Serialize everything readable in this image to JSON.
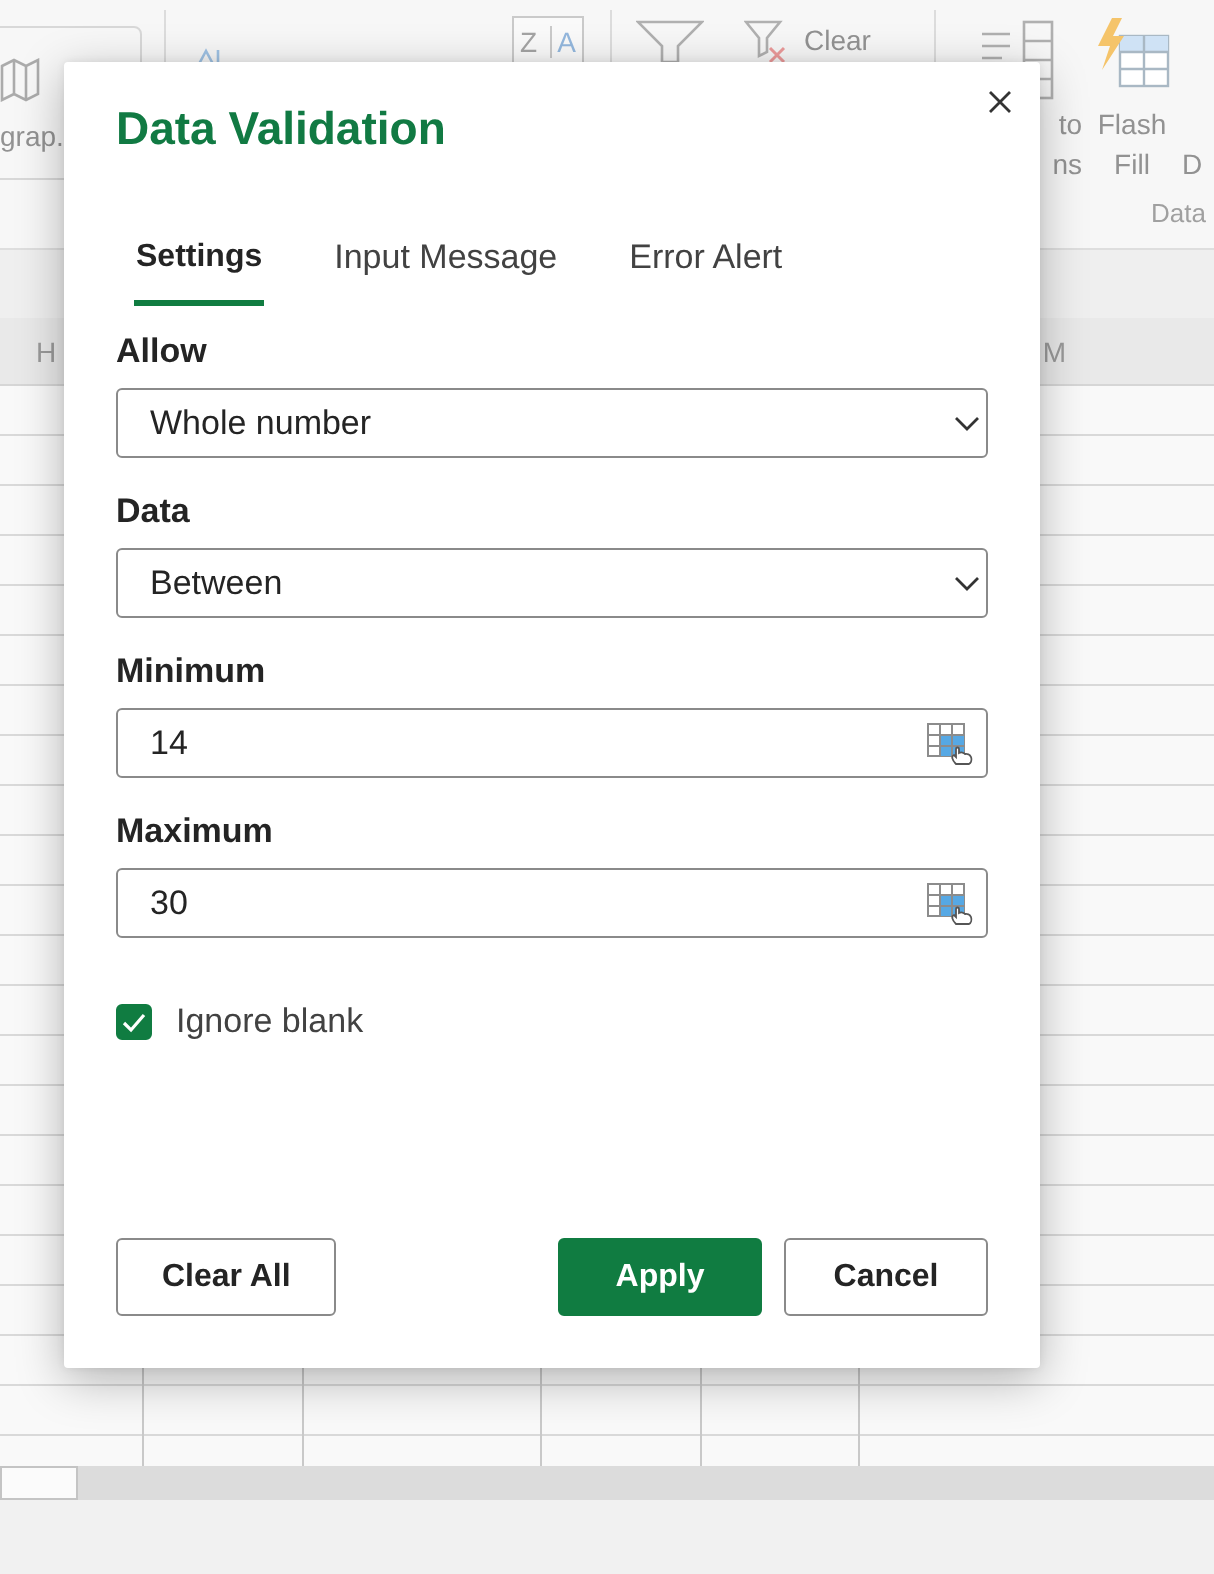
{
  "ribbon": {
    "groups": [
      {
        "buttons": [
          {
            "kind": "map",
            "lines": [
              "grap."
            ]
          }
        ]
      },
      {
        "buttons": [
          {
            "kind": "sort-ascending"
          },
          {
            "kind": "sort-descending",
            "letters": [
              "Z",
              "A"
            ]
          }
        ]
      },
      {
        "buttons": [
          {
            "kind": "filter"
          },
          {
            "kind": "clear-filter",
            "lines": [
              "Clear"
            ]
          }
        ]
      },
      {
        "buttons": [
          {
            "kind": "text-to-columns",
            "lines": [
              "to",
              "ns"
            ]
          },
          {
            "kind": "flash-fill",
            "lines": [
              "Flash",
              "Fill"
            ]
          },
          {
            "kind": "cut-off",
            "lines": [
              "D"
            ]
          }
        ],
        "label": "Data"
      }
    ]
  },
  "column_headers": [
    {
      "label": "H"
    },
    {
      "label": "M"
    }
  ],
  "dialog": {
    "title": "Data Validation",
    "tabs": [
      {
        "label": "Settings",
        "selected": true
      },
      {
        "label": "Input Message",
        "selected": false
      },
      {
        "label": "Error Alert",
        "selected": false
      }
    ],
    "fields": [
      {
        "kind": "dropdown",
        "label": "Allow",
        "value": "Whole number"
      },
      {
        "kind": "dropdown",
        "label": "Data",
        "value": "Between"
      },
      {
        "kind": "range",
        "label": "Minimum",
        "value": "14"
      },
      {
        "kind": "range",
        "label": "Maximum",
        "value": "30"
      }
    ],
    "ignore_blank": {
      "label": "Ignore blank",
      "checked": true
    },
    "buttons": [
      {
        "kind": "secondary",
        "label": "Clear All"
      },
      {
        "kind": "primary",
        "label": "Apply"
      },
      {
        "kind": "secondary",
        "label": "Cancel"
      }
    ]
  }
}
